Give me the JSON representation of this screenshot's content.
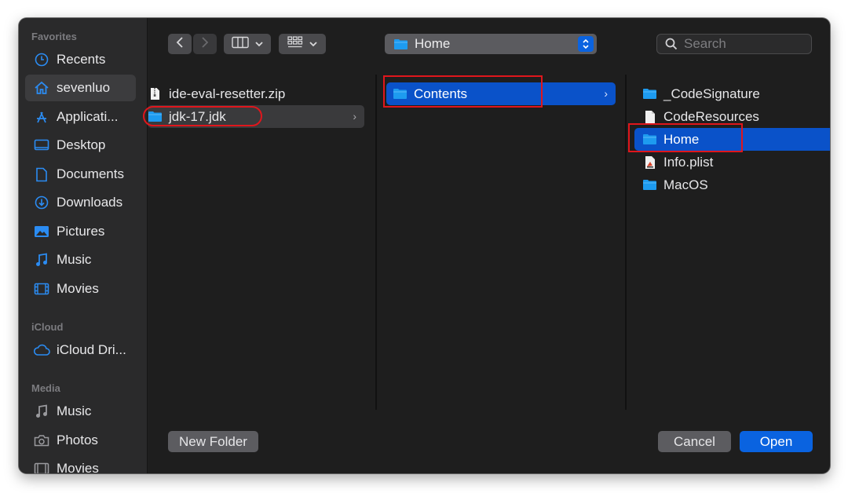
{
  "sidebar": {
    "favorites_header": "Favorites",
    "favorites": [
      {
        "label": "Recents",
        "icon": "clock-icon"
      },
      {
        "label": "sevenluo",
        "icon": "home-icon",
        "selected": true
      },
      {
        "label": "Applicati...",
        "icon": "applications-icon"
      },
      {
        "label": "Desktop",
        "icon": "desktop-icon"
      },
      {
        "label": "Documents",
        "icon": "document-icon"
      },
      {
        "label": "Downloads",
        "icon": "download-icon"
      },
      {
        "label": "Pictures",
        "icon": "pictures-icon"
      },
      {
        "label": "Music",
        "icon": "music-icon"
      },
      {
        "label": "Movies",
        "icon": "movies-icon"
      }
    ],
    "icloud_header": "iCloud",
    "icloud": [
      {
        "label": "iCloud Dri...",
        "icon": "cloud-icon"
      }
    ],
    "media_header": "Media",
    "media": [
      {
        "label": "Music",
        "icon": "music-icon"
      },
      {
        "label": "Photos",
        "icon": "camera-icon"
      },
      {
        "label": "Movies",
        "icon": "movies-icon"
      }
    ]
  },
  "toolbar": {
    "path_label": "Home",
    "search_placeholder": "Search"
  },
  "columns": [
    {
      "items": [
        {
          "label": "ide-eval-resetter.zip",
          "icon": "zip-file-icon"
        },
        {
          "label": "jdk-17.jdk",
          "icon": "folder-icon",
          "selected": "inactive",
          "has_children": true
        }
      ]
    },
    {
      "items": [
        {
          "label": "Contents",
          "icon": "folder-icon",
          "selected": "active",
          "has_children": true
        }
      ]
    },
    {
      "items": [
        {
          "label": "_CodeSignature",
          "icon": "folder-icon"
        },
        {
          "label": "CodeResources",
          "icon": "file-icon"
        },
        {
          "label": "Home",
          "icon": "folder-icon",
          "selected": "active"
        },
        {
          "label": "Info.plist",
          "icon": "plist-file-icon"
        },
        {
          "label": "MacOS",
          "icon": "folder-icon"
        }
      ]
    }
  ],
  "footer": {
    "new_folder_label": "New Folder",
    "cancel_label": "Cancel",
    "open_label": "Open"
  },
  "colors": {
    "accent": "#0a52c9",
    "folder": "#1d9bf0",
    "annotation": "#e0161c"
  }
}
